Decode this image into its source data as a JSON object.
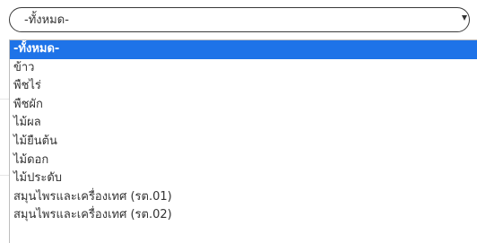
{
  "select": {
    "selected_value": "-ทั้งหมด-",
    "arrow_icon": "chevron-down-icon"
  },
  "dropdown": {
    "selected_index": 0,
    "options": [
      {
        "label": "-ทั้งหมด-"
      },
      {
        "label": "ข้าว"
      },
      {
        "label": "พืชไร่"
      },
      {
        "label": "พืชผัก"
      },
      {
        "label": "ไม้ผล"
      },
      {
        "label": "ไม้ยืนต้น"
      },
      {
        "label": "ไม้ดอก"
      },
      {
        "label": "ไม้ประดับ"
      },
      {
        "label": "สมุนไพรและเครื่องเทศ (รต.01)"
      },
      {
        "label": "สมุนไพรและเครื่องเทศ (รต.02)"
      }
    ]
  },
  "colors": {
    "selected_bg": "#1e73e8",
    "text": "#333333",
    "border": "#3a3a3a"
  }
}
